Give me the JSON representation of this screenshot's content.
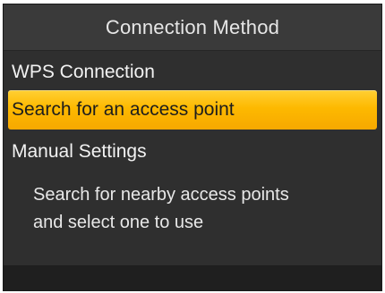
{
  "header": {
    "title": "Connection Method"
  },
  "menu": {
    "items": [
      {
        "label": "WPS Connection",
        "selected": false
      },
      {
        "label": "Search for an access point",
        "selected": true
      },
      {
        "label": "Manual Settings",
        "selected": false
      }
    ]
  },
  "description": {
    "line1": "Search for nearby access points",
    "line2": "and select one to use"
  },
  "colors": {
    "background": "#2f2f2f",
    "highlight": "#fdb900",
    "text": "#f2f2f2"
  }
}
